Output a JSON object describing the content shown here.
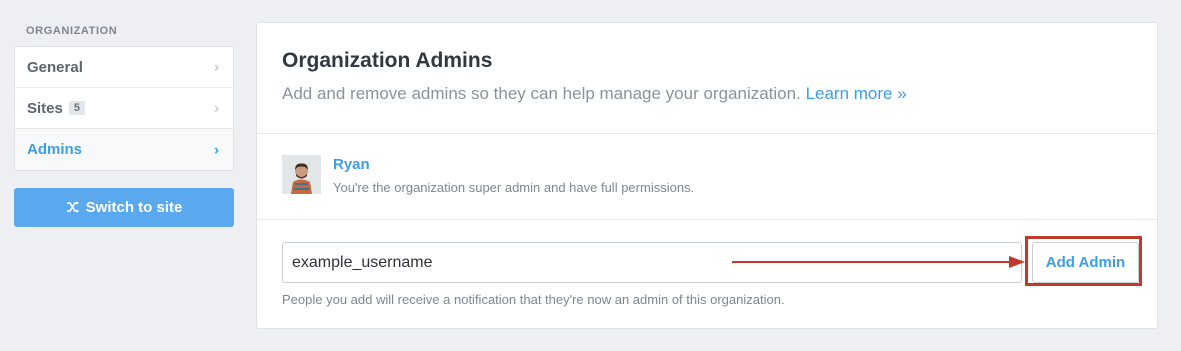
{
  "sidebar": {
    "section_label": "ORGANIZATION",
    "items": [
      {
        "label": "General",
        "badge": null,
        "active": false
      },
      {
        "label": "Sites",
        "badge": "5",
        "active": false
      },
      {
        "label": "Admins",
        "badge": null,
        "active": true
      }
    ],
    "switch_button_label": "Switch to site"
  },
  "main": {
    "title": "Organization Admins",
    "subtitle": "Add and remove admins so they can help manage your organization.",
    "learn_more": "Learn more »",
    "admins": [
      {
        "name": "Ryan",
        "description": "You're the organization super admin and have full permissions."
      }
    ],
    "add_form": {
      "input_value": "example_username",
      "button_label": "Add Admin",
      "hint": "People you add will receive a notification that they're now an admin of this organization."
    }
  },
  "colors": {
    "accent": "#3d9ee6",
    "button_blue": "#5aa8ee",
    "annotation_red": "#c0392b",
    "background": "#edeff3"
  },
  "icons": {
    "nav_chevron": "chevron-right-icon",
    "switch": "shuffle-icon"
  }
}
